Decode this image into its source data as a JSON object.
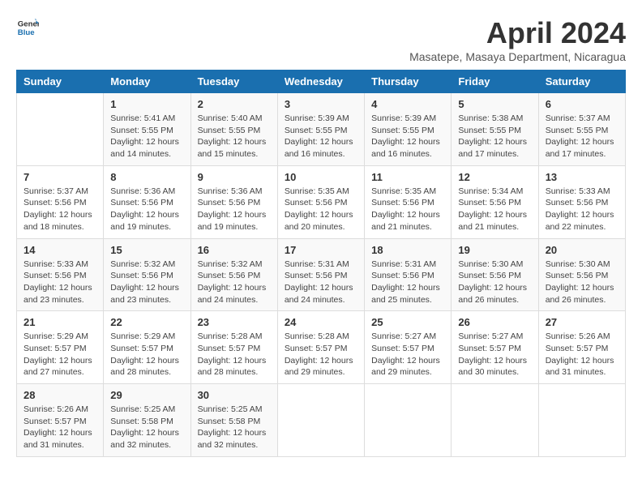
{
  "header": {
    "logo_general": "General",
    "logo_blue": "Blue",
    "month_title": "April 2024",
    "subtitle": "Masatepe, Masaya Department, Nicaragua"
  },
  "columns": [
    "Sunday",
    "Monday",
    "Tuesday",
    "Wednesday",
    "Thursday",
    "Friday",
    "Saturday"
  ],
  "weeks": [
    [
      {
        "day": "",
        "detail": ""
      },
      {
        "day": "1",
        "detail": "Sunrise: 5:41 AM\nSunset: 5:55 PM\nDaylight: 12 hours\nand 14 minutes."
      },
      {
        "day": "2",
        "detail": "Sunrise: 5:40 AM\nSunset: 5:55 PM\nDaylight: 12 hours\nand 15 minutes."
      },
      {
        "day": "3",
        "detail": "Sunrise: 5:39 AM\nSunset: 5:55 PM\nDaylight: 12 hours\nand 16 minutes."
      },
      {
        "day": "4",
        "detail": "Sunrise: 5:39 AM\nSunset: 5:55 PM\nDaylight: 12 hours\nand 16 minutes."
      },
      {
        "day": "5",
        "detail": "Sunrise: 5:38 AM\nSunset: 5:55 PM\nDaylight: 12 hours\nand 17 minutes."
      },
      {
        "day": "6",
        "detail": "Sunrise: 5:37 AM\nSunset: 5:55 PM\nDaylight: 12 hours\nand 17 minutes."
      }
    ],
    [
      {
        "day": "7",
        "detail": "Sunrise: 5:37 AM\nSunset: 5:56 PM\nDaylight: 12 hours\nand 18 minutes."
      },
      {
        "day": "8",
        "detail": "Sunrise: 5:36 AM\nSunset: 5:56 PM\nDaylight: 12 hours\nand 19 minutes."
      },
      {
        "day": "9",
        "detail": "Sunrise: 5:36 AM\nSunset: 5:56 PM\nDaylight: 12 hours\nand 19 minutes."
      },
      {
        "day": "10",
        "detail": "Sunrise: 5:35 AM\nSunset: 5:56 PM\nDaylight: 12 hours\nand 20 minutes."
      },
      {
        "day": "11",
        "detail": "Sunrise: 5:35 AM\nSunset: 5:56 PM\nDaylight: 12 hours\nand 21 minutes."
      },
      {
        "day": "12",
        "detail": "Sunrise: 5:34 AM\nSunset: 5:56 PM\nDaylight: 12 hours\nand 21 minutes."
      },
      {
        "day": "13",
        "detail": "Sunrise: 5:33 AM\nSunset: 5:56 PM\nDaylight: 12 hours\nand 22 minutes."
      }
    ],
    [
      {
        "day": "14",
        "detail": "Sunrise: 5:33 AM\nSunset: 5:56 PM\nDaylight: 12 hours\nand 23 minutes."
      },
      {
        "day": "15",
        "detail": "Sunrise: 5:32 AM\nSunset: 5:56 PM\nDaylight: 12 hours\nand 23 minutes."
      },
      {
        "day": "16",
        "detail": "Sunrise: 5:32 AM\nSunset: 5:56 PM\nDaylight: 12 hours\nand 24 minutes."
      },
      {
        "day": "17",
        "detail": "Sunrise: 5:31 AM\nSunset: 5:56 PM\nDaylight: 12 hours\nand 24 minutes."
      },
      {
        "day": "18",
        "detail": "Sunrise: 5:31 AM\nSunset: 5:56 PM\nDaylight: 12 hours\nand 25 minutes."
      },
      {
        "day": "19",
        "detail": "Sunrise: 5:30 AM\nSunset: 5:56 PM\nDaylight: 12 hours\nand 26 minutes."
      },
      {
        "day": "20",
        "detail": "Sunrise: 5:30 AM\nSunset: 5:56 PM\nDaylight: 12 hours\nand 26 minutes."
      }
    ],
    [
      {
        "day": "21",
        "detail": "Sunrise: 5:29 AM\nSunset: 5:57 PM\nDaylight: 12 hours\nand 27 minutes."
      },
      {
        "day": "22",
        "detail": "Sunrise: 5:29 AM\nSunset: 5:57 PM\nDaylight: 12 hours\nand 28 minutes."
      },
      {
        "day": "23",
        "detail": "Sunrise: 5:28 AM\nSunset: 5:57 PM\nDaylight: 12 hours\nand 28 minutes."
      },
      {
        "day": "24",
        "detail": "Sunrise: 5:28 AM\nSunset: 5:57 PM\nDaylight: 12 hours\nand 29 minutes."
      },
      {
        "day": "25",
        "detail": "Sunrise: 5:27 AM\nSunset: 5:57 PM\nDaylight: 12 hours\nand 29 minutes."
      },
      {
        "day": "26",
        "detail": "Sunrise: 5:27 AM\nSunset: 5:57 PM\nDaylight: 12 hours\nand 30 minutes."
      },
      {
        "day": "27",
        "detail": "Sunrise: 5:26 AM\nSunset: 5:57 PM\nDaylight: 12 hours\nand 31 minutes."
      }
    ],
    [
      {
        "day": "28",
        "detail": "Sunrise: 5:26 AM\nSunset: 5:57 PM\nDaylight: 12 hours\nand 31 minutes."
      },
      {
        "day": "29",
        "detail": "Sunrise: 5:25 AM\nSunset: 5:58 PM\nDaylight: 12 hours\nand 32 minutes."
      },
      {
        "day": "30",
        "detail": "Sunrise: 5:25 AM\nSunset: 5:58 PM\nDaylight: 12 hours\nand 32 minutes."
      },
      {
        "day": "",
        "detail": ""
      },
      {
        "day": "",
        "detail": ""
      },
      {
        "day": "",
        "detail": ""
      },
      {
        "day": "",
        "detail": ""
      }
    ]
  ]
}
